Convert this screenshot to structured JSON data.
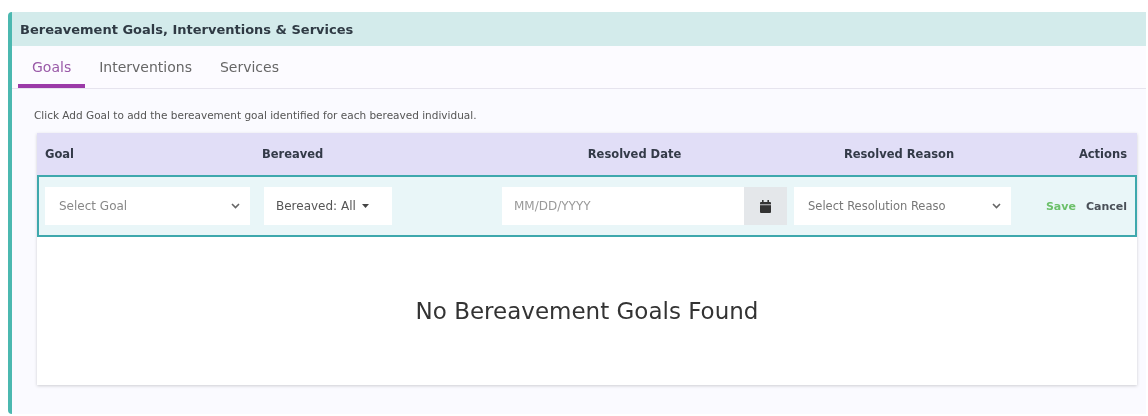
{
  "panel": {
    "title": "Bereavement Goals, Interventions & Services"
  },
  "tabs": [
    {
      "label": "Goals",
      "selected": true
    },
    {
      "label": "Interventions",
      "selected": false
    },
    {
      "label": "Services",
      "selected": false
    }
  ],
  "instructions": "Click Add Goal to add the bereavement goal identified for each bereaved individual.",
  "table": {
    "columns": [
      "Goal",
      "Bereaved",
      "Resolved Date",
      "Resolved Reason",
      "Actions"
    ],
    "edit_row": {
      "goal": {
        "placeholder": "Select Goal"
      },
      "bereaved": {
        "value": "Bereaved: All"
      },
      "resolved_date": {
        "placeholder": "MM/DD/YYYY"
      },
      "resolved_reason": {
        "placeholder": "Select Resolution Reaso"
      },
      "actions": [
        {
          "label": "Save",
          "kind": "save"
        },
        {
          "label": "Cancel",
          "kind": "cancel"
        }
      ]
    },
    "empty_message": "No Bereavement Goals Found"
  }
}
